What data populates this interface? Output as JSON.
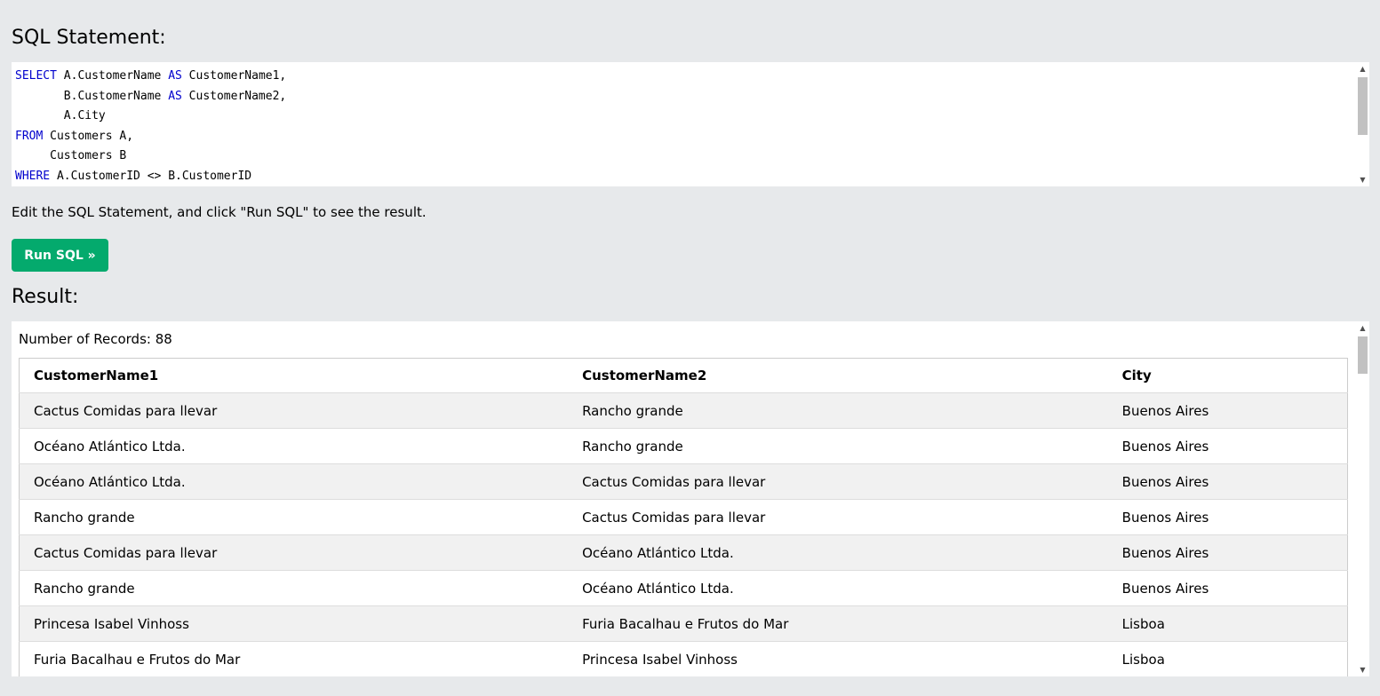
{
  "sql_section": {
    "title": "SQL Statement:",
    "keywords": [
      "SELECT",
      "AS",
      "FROM",
      "WHERE"
    ]
  },
  "hint": "Edit the SQL Statement, and click \"Run SQL\" to see the result.",
  "run_button": {
    "label": "Run SQL »",
    "color": "#04aa6d"
  },
  "result_section": {
    "title": "Result:",
    "record_count": "Number of Records: 88",
    "columns": [
      "CustomerName1",
      "CustomerName2",
      "City"
    ],
    "rows": [
      [
        "Cactus Comidas para llevar",
        "Rancho grande",
        "Buenos Aires"
      ],
      [
        "Océano Atlántico Ltda.",
        "Rancho grande",
        "Buenos Aires"
      ],
      [
        "Océano Atlántico Ltda.",
        "Cactus Comidas para llevar",
        "Buenos Aires"
      ],
      [
        "Rancho grande",
        "Cactus Comidas para llevar",
        "Buenos Aires"
      ],
      [
        "Cactus Comidas para llevar",
        "Océano Atlántico Ltda.",
        "Buenos Aires"
      ],
      [
        "Rancho grande",
        "Océano Atlántico Ltda.",
        "Buenos Aires"
      ],
      [
        "Princesa Isabel Vinhoss",
        "Furia Bacalhau e Frutos do Mar",
        "Lisboa"
      ],
      [
        "Furia Bacalhau e Frutos do Mar",
        "Princesa Isabel Vinhoss",
        "Lisboa"
      ]
    ]
  },
  "colors": {
    "background": "#e7e9eb",
    "keyword": "#0000cd",
    "stripe": "#f1f1f1"
  }
}
